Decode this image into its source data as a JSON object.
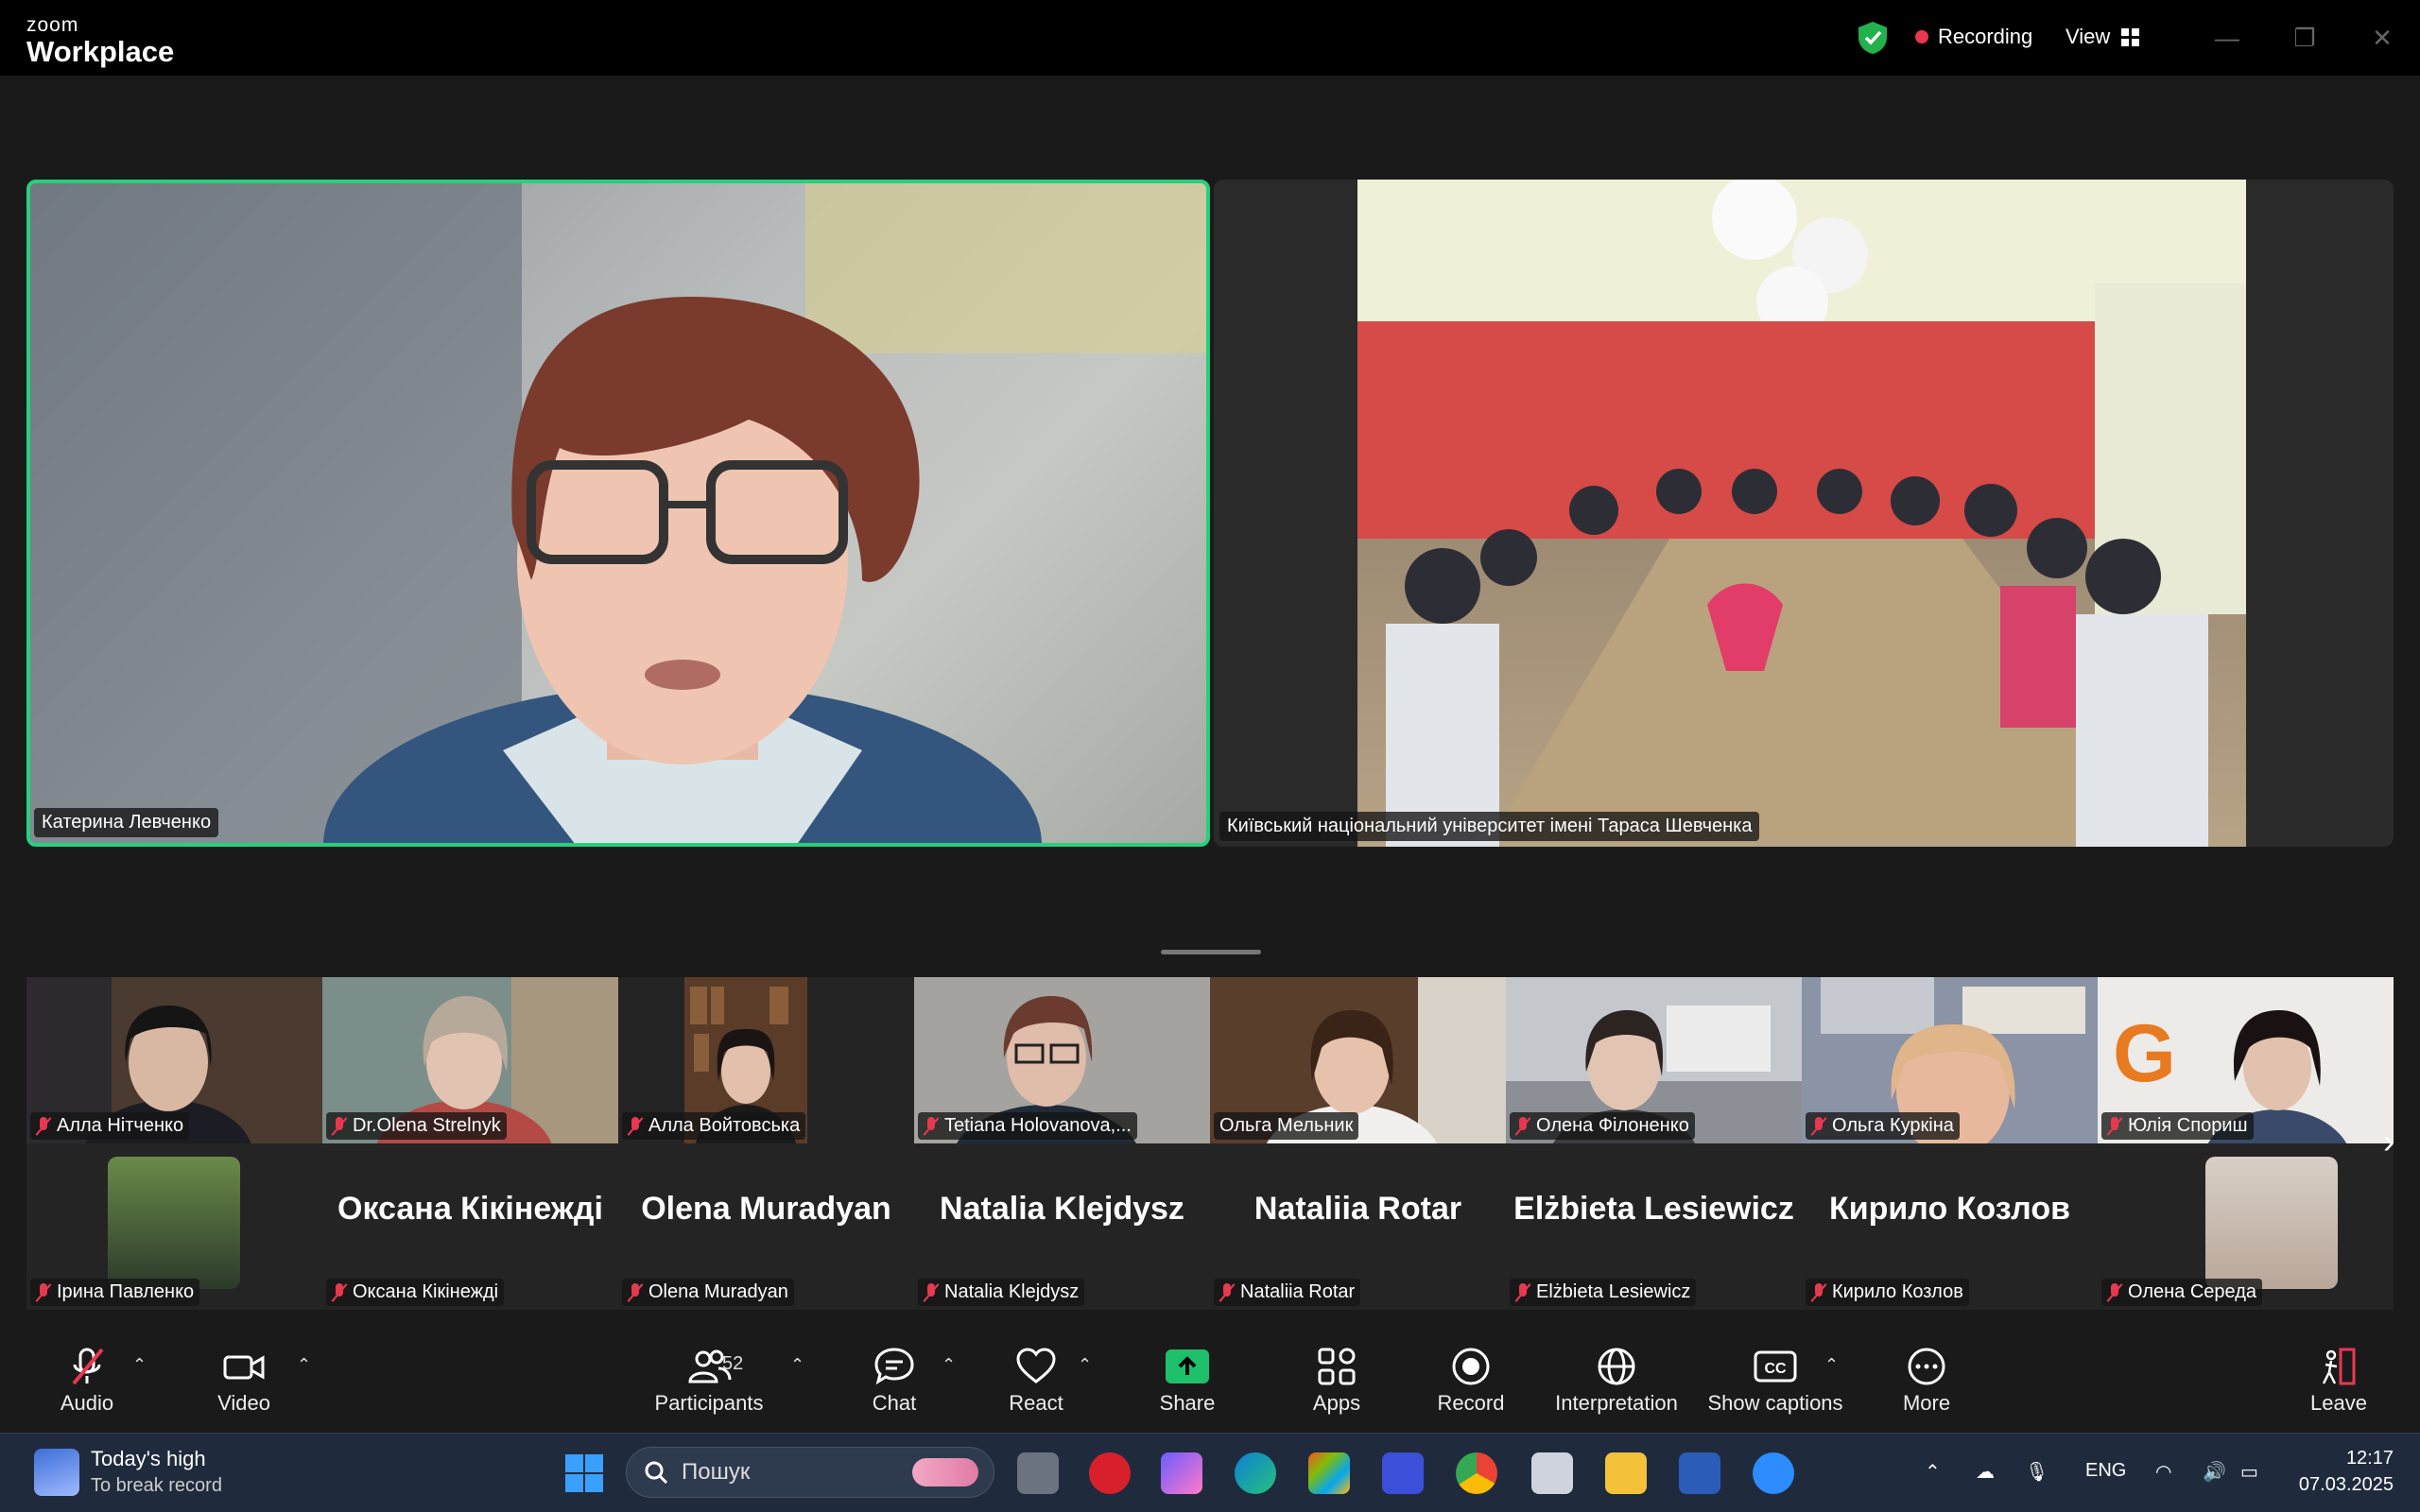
{
  "app": {
    "brand_small": "zoom",
    "brand_large": "Workplace"
  },
  "header": {
    "recording_label": "Recording",
    "view_label": "View",
    "colors": {
      "secure": "#23b14d",
      "recording_dot": "#e8384f"
    }
  },
  "main_tiles": [
    {
      "name": "Катерина Левченко",
      "active_speaker": true
    },
    {
      "name": "Київський національний університет імені Тараса Шевченка"
    }
  ],
  "gallery": {
    "row1": [
      {
        "name": "Алла Нітченко",
        "muted": true
      },
      {
        "name": "Dr.Olena Strelnyk",
        "muted": true
      },
      {
        "name": "Алла Войтовська",
        "muted": true
      },
      {
        "name": "Tetiana Holovanova,...",
        "muted": true
      },
      {
        "name": "Ольга Мельник",
        "muted": false
      },
      {
        "name": "Олена Філоненко",
        "muted": true
      },
      {
        "name": "Ольга Куркіна",
        "muted": true
      },
      {
        "name": "Юлія Спориш",
        "muted": true
      }
    ],
    "row2": [
      {
        "name": "Ірина Павленко",
        "muted": true,
        "big_name": ""
      },
      {
        "name": "Оксана Кікінежді",
        "muted": true,
        "big_name": "Оксана Кікінежді"
      },
      {
        "name": "Olena Muradyan",
        "muted": true,
        "big_name": "Olena Muradyan"
      },
      {
        "name": "Natalia Klejdysz",
        "muted": true,
        "big_name": "Natalia Klejdysz"
      },
      {
        "name": "Nataliia Rotar",
        "muted": true,
        "big_name": "Nataliia Rotar"
      },
      {
        "name": "Elżbieta Lesiewicz",
        "muted": true,
        "big_name": "Elżbieta Lesiewicz"
      },
      {
        "name": "Кирило Козлов",
        "muted": true,
        "big_name": "Кирило Козлов"
      },
      {
        "name": "Олена Середа",
        "muted": true,
        "big_name": ""
      }
    ]
  },
  "toolbar": {
    "audio": "Audio",
    "video": "Video",
    "participants": "Participants",
    "participants_count": "52",
    "chat": "Chat",
    "react": "React",
    "share": "Share",
    "apps": "Apps",
    "record": "Record",
    "interpretation": "Interpretation",
    "captions": "Show captions",
    "more": "More",
    "leave": "Leave",
    "colors": {
      "share": "#1fc06a",
      "leave": "#e8384f",
      "active_border": "#26d07c"
    }
  },
  "taskbar": {
    "weather_title": "Today's high",
    "weather_sub": "To break record",
    "search_placeholder": "Пошук",
    "lang": "ENG",
    "time": "12:17",
    "date": "07.03.2025"
  }
}
